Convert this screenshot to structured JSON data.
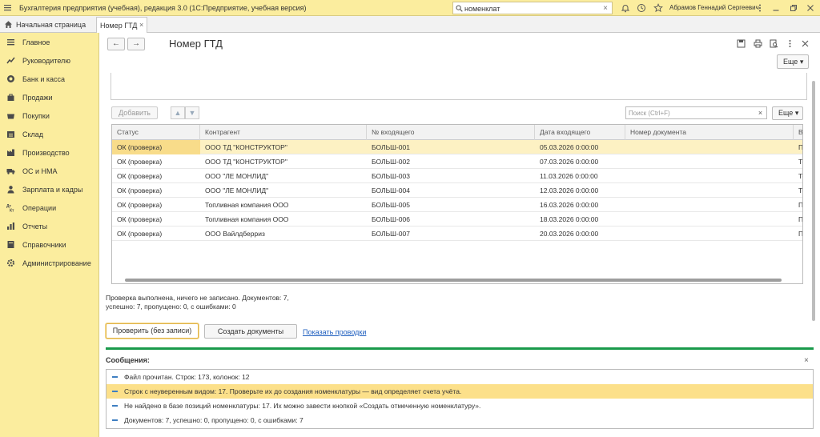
{
  "topbar": {
    "title": "Бухгалтерия предприятия (учебная), редакция 3.0  (1С:Предприятие, учебная версия)",
    "search_value": "номенклат",
    "user": "Абрамов Геннадий Сергеевич"
  },
  "tabs": {
    "home_label": "Начальная страница",
    "active_label": "Номер ГТД"
  },
  "sidebar": {
    "items": [
      {
        "label": "Главное",
        "icon": "menu-icon"
      },
      {
        "label": "Руководителю",
        "icon": "trend-icon"
      },
      {
        "label": "Банк и касса",
        "icon": "coin-icon"
      },
      {
        "label": "Продажи",
        "icon": "bag-icon"
      },
      {
        "label": "Покупки",
        "icon": "basket-icon"
      },
      {
        "label": "Склад",
        "icon": "warehouse-icon"
      },
      {
        "label": "Производство",
        "icon": "factory-icon"
      },
      {
        "label": "ОС и НМА",
        "icon": "truck-icon"
      },
      {
        "label": "Зарплата и кадры",
        "icon": "person-icon"
      },
      {
        "label": "Операции",
        "icon": "dt-kt-icon"
      },
      {
        "label": "Отчеты",
        "icon": "report-icon"
      },
      {
        "label": "Справочники",
        "icon": "book-icon"
      },
      {
        "label": "Администрирование",
        "icon": "gear-icon"
      }
    ]
  },
  "form": {
    "title": "Номер ГТД",
    "more_label": "Еще",
    "add_label": "Добавить",
    "search_placeholder": "Поиск (Ctrl+F)",
    "table_more_label": "Еще"
  },
  "table": {
    "columns": [
      "Статус",
      "Контрагент",
      "№ входящего",
      "Дата входящего",
      "Номер документа",
      "В"
    ],
    "rows": [
      [
        "ОК (проверка)",
        "ООО ТД \"КОНСТРУКТОР\"",
        "БОЛЬШ-001",
        "05.03.2026 0:00:00",
        "",
        "П"
      ],
      [
        "ОК (проверка)",
        "ООО ТД \"КОНСТРУКТОР\"",
        "БОЛЬШ-002",
        "07.03.2026 0:00:00",
        "",
        "То"
      ],
      [
        "ОК (проверка)",
        "ООО \"ЛЕ МОНЛИД\"",
        "БОЛЬШ-003",
        "11.03.2026 0:00:00",
        "",
        "То"
      ],
      [
        "ОК (проверка)",
        "ООО \"ЛЕ МОНЛИД\"",
        "БОЛЬШ-004",
        "12.03.2026 0:00:00",
        "",
        "То"
      ],
      [
        "ОК (проверка)",
        "Топливная компания ООО",
        "БОЛЬШ-005",
        "16.03.2026 0:00:00",
        "",
        "П"
      ],
      [
        "ОК (проверка)",
        "Топливная компания ООО",
        "БОЛЬШ-006",
        "18.03.2026 0:00:00",
        "",
        "П"
      ],
      [
        "ОК (проверка)",
        "ООО Вайлдберриз",
        "БОЛЬШ-007",
        "20.03.2026 0:00:00",
        "",
        "П"
      ]
    ]
  },
  "status": {
    "line1": "Проверка выполнена, ничего не записано. Документов: 7,",
    "line2": "успешно: 7, пропущено: 0, с ошибками: 0"
  },
  "actions": {
    "check_label": "Проверить (без записи)",
    "create_label": "Создать документы",
    "postings_link": "Показать проводки"
  },
  "messages": {
    "title": "Сообщения:",
    "items": [
      "Файл прочитан. Строк: 173, колонок: 12",
      "Строк с неуверенным видом: 17. Проверьте их до создания номенклатуры — вид определяет счета учёта.",
      "Не найдено в базе позиций номенклатуры: 17. Их можно завести кнопкой «Создать отмеченную номенклатуру».",
      "Документов: 7, успешно: 0, пропущено: 0, с ошибками: 7"
    ]
  },
  "colors": {
    "accent_yellow": "#fbed9e",
    "selection": "#fdf1c3",
    "success_bar": "#1a9a4b",
    "link": "#1f5fbf"
  }
}
